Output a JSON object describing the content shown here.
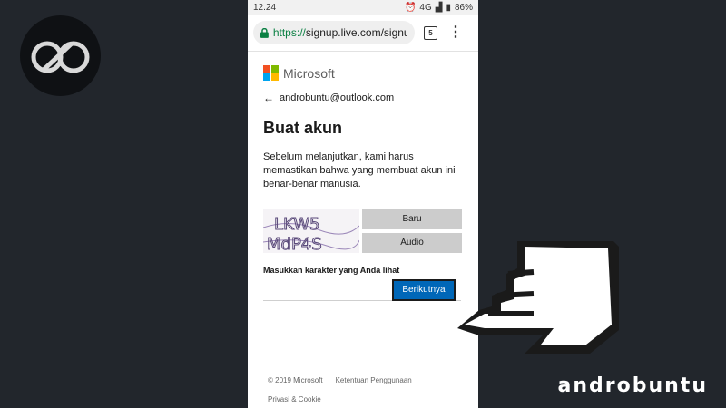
{
  "status_bar": {
    "time": "12.24",
    "network": "4G",
    "battery": "86%"
  },
  "browser": {
    "url_scheme": "https://",
    "url_rest": "signup.live.com/signu",
    "tab_count": "5",
    "menu_glyph": "⋮"
  },
  "signup": {
    "brand": "Microsoft",
    "account": "androbuntu@outlook.com",
    "back_glyph": "←",
    "title": "Buat akun",
    "description": "Sebelum melanjutkan, kami harus memastikan bahwa yang membuat akun ini benar-benar manusia.",
    "captcha_text_line1": "LKW5",
    "captcha_text_line2": "MdP4S",
    "new_button": "Baru",
    "audio_button": "Audio",
    "captcha_label": "Masukkan karakter yang Anda lihat",
    "next_button": "Berikutnya"
  },
  "footer": {
    "copyright": "© 2019 Microsoft",
    "terms": "Ketentuan Penggunaan",
    "privacy": "Privasi & Cookie"
  },
  "watermark": {
    "brand": "androbuntu"
  },
  "colors": {
    "ms_red": "#f25022",
    "ms_green": "#7fba00",
    "ms_blue": "#00a4ef",
    "ms_yellow": "#ffb900",
    "button_blue": "#0067b8",
    "background": "#22262c"
  }
}
